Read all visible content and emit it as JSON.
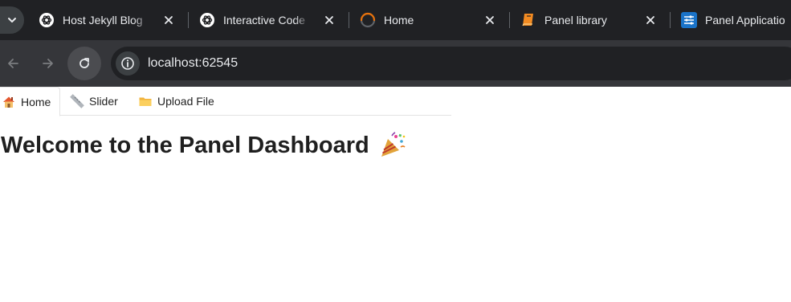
{
  "browser": {
    "tabs": [
      {
        "title": "Host Jekyll Blog",
        "icon": "openai-logo-icon"
      },
      {
        "title": "Interactive Code",
        "icon": "openai-logo-icon"
      },
      {
        "title": "Home",
        "icon": "loading-spinner-icon"
      },
      {
        "title": "Panel library",
        "icon": "book-icon"
      },
      {
        "title": "Panel Applicatio",
        "icon": "panel-logo-icon"
      }
    ],
    "url": "localhost:62545"
  },
  "app": {
    "nav_tabs": [
      {
        "label": "Home",
        "icon": "house-icon"
      },
      {
        "label": "Slider",
        "icon": "ruler-icon"
      },
      {
        "label": "Upload File",
        "icon": "folder-icon"
      }
    ],
    "heading": "Welcome to the Panel Dashboard",
    "heading_icon": "party-popper-icon"
  },
  "colors": {
    "tabstrip_bg": "#202124",
    "toolbar_bg": "#35363a",
    "spinner_accent": "#e8710a",
    "book_accent": "#f28b22",
    "panel_logo": "#1a73c8"
  }
}
